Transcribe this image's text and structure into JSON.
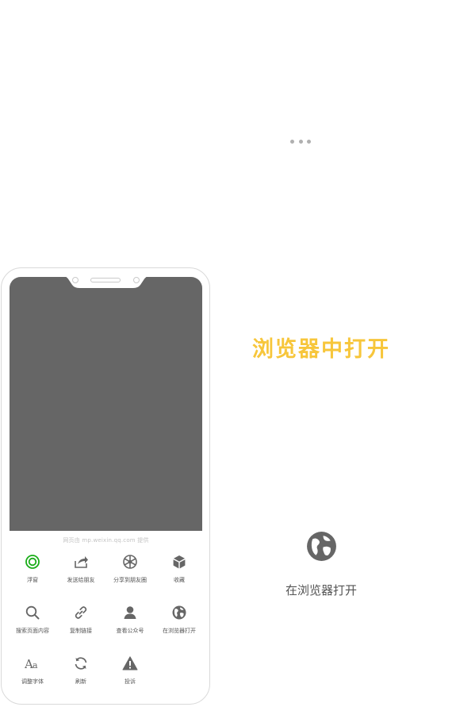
{
  "page": {
    "provider_text": "网页由 mp.weixin.qq.com 提供",
    "highlight_title": "浏览器中打开",
    "highlight_action_label": "在浏览器打开"
  },
  "colors": {
    "accent_yellow": "#f7c63b",
    "wechat_green": "#1aad19",
    "icon_gray": "#666666",
    "screen_gray": "#666666"
  },
  "menu": {
    "items": [
      {
        "label": "浮窗",
        "icon": "floating-window-icon"
      },
      {
        "label": "发送给朋友",
        "icon": "share-forward-icon"
      },
      {
        "label": "分享到朋友圈",
        "icon": "moments-shutter-icon"
      },
      {
        "label": "收藏",
        "icon": "favorite-cube-icon"
      },
      {
        "label": "搜索页面内容",
        "icon": "search-icon"
      },
      {
        "label": "复制链接",
        "icon": "link-icon"
      },
      {
        "label": "查看公众号",
        "icon": "person-icon"
      },
      {
        "label": "在浏览器打开",
        "icon": "globe-icon"
      },
      {
        "label": "调整字体",
        "icon": "font-size-icon"
      },
      {
        "label": "刷新",
        "icon": "refresh-icon"
      },
      {
        "label": "投诉",
        "icon": "warning-icon"
      }
    ]
  }
}
